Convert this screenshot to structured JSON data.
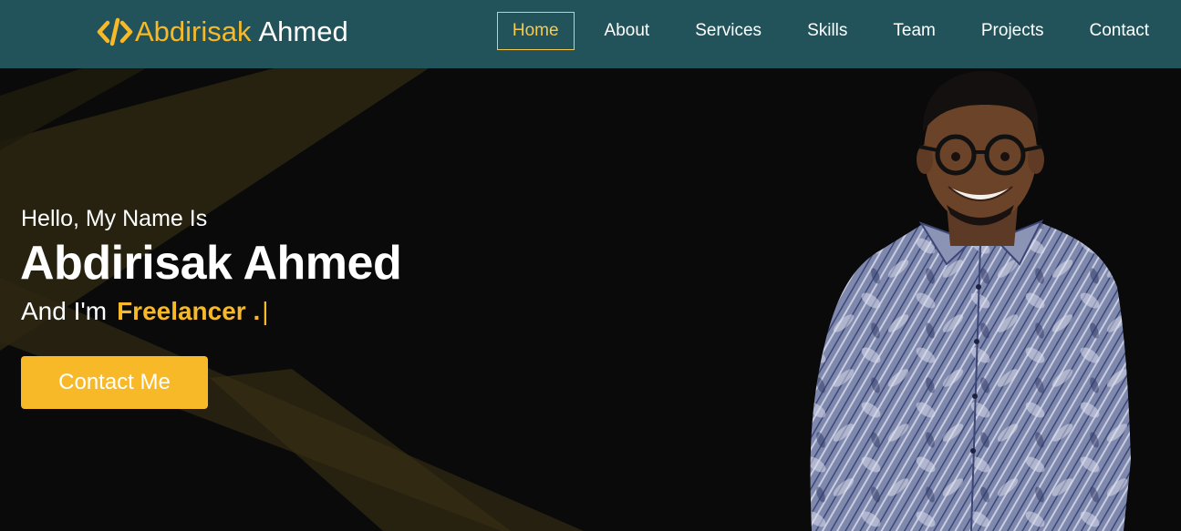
{
  "brand": {
    "icon": "code-icon",
    "first_name": "Abdirisak",
    "last_name": "Ahmed",
    "accent_color": "#f7b928"
  },
  "nav": {
    "items": [
      {
        "label": "Home",
        "active": true
      },
      {
        "label": "About",
        "active": false
      },
      {
        "label": "Services",
        "active": false
      },
      {
        "label": "Skills",
        "active": false
      },
      {
        "label": "Team",
        "active": false
      },
      {
        "label": "Projects",
        "active": false
      },
      {
        "label": "Contact",
        "active": false
      }
    ],
    "background": "#22535a"
  },
  "hero": {
    "greeting": "Hello, My Name Is",
    "name": "Abdirisak Ahmed",
    "role_prefix": "And I'm",
    "role": "Freelancer .",
    "caret": "|",
    "cta_label": "Contact Me",
    "portrait": "portrait-photo"
  }
}
